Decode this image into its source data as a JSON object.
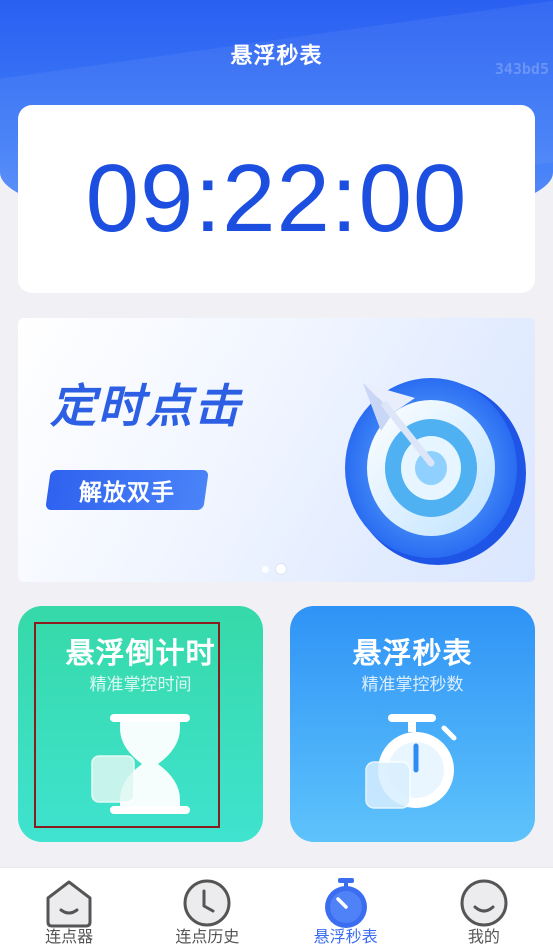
{
  "header": {
    "title": "悬浮秒表",
    "watermark": "343bd5"
  },
  "clock": {
    "time": "09:22:00"
  },
  "banner": {
    "title": "定时点击",
    "button_label": "解放双手",
    "icon": "target-arrow-icon",
    "slides": 2,
    "active_slide": 2
  },
  "cards": [
    {
      "title": "悬浮倒计时",
      "subtitle": "精准掌控时间",
      "icon": "hourglass-icon",
      "color": "#36d9a8"
    },
    {
      "title": "悬浮秒表",
      "subtitle": "精准掌控秒数",
      "icon": "stopwatch-icon",
      "color": "#2f93f6"
    }
  ],
  "tabbar": {
    "items": [
      {
        "label": "连点器",
        "icon": "home-icon",
        "active": false
      },
      {
        "label": "连点历史",
        "icon": "clock-icon",
        "active": false
      },
      {
        "label": "悬浮秒表",
        "icon": "stopwatch-icon",
        "active": true
      },
      {
        "label": "我的",
        "icon": "profile-icon",
        "active": false
      }
    ],
    "active_color": "#3b6df0"
  }
}
